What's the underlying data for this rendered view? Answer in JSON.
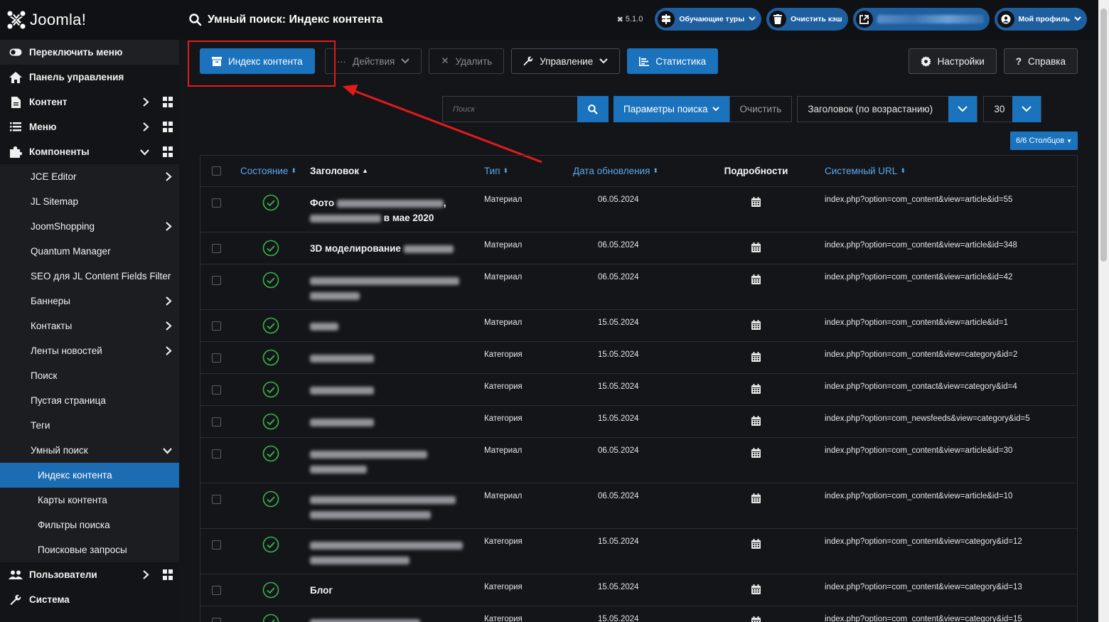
{
  "header": {
    "brand": "Joomla!",
    "title": "Умный поиск: Индекс контента",
    "version": "5.1.0",
    "tours_label": "Обучающие туры",
    "clear_cache_label": "Очистить кэш",
    "profile_label": "Мой профиль"
  },
  "sidebar": {
    "items": [
      {
        "label": "Переключить меню",
        "icon": "toggle-icon"
      },
      {
        "label": "Панель управления",
        "icon": "home-icon"
      },
      {
        "label": "Контент",
        "icon": "file-icon"
      },
      {
        "label": "Меню",
        "icon": "list-icon"
      },
      {
        "label": "Компоненты",
        "icon": "puzzle-icon"
      },
      {
        "label": "JCE Editor"
      },
      {
        "label": "JL Sitemap"
      },
      {
        "label": "JoomShopping"
      },
      {
        "label": "Quantum Manager"
      },
      {
        "label": "SEO для JL Content Fields Filter"
      },
      {
        "label": "Баннеры"
      },
      {
        "label": "Контакты"
      },
      {
        "label": "Ленты новостей"
      },
      {
        "label": "Поиск"
      },
      {
        "label": "Пустая страница"
      },
      {
        "label": "Теги"
      },
      {
        "label": "Умный поиск"
      },
      {
        "label": "Индекс контента"
      },
      {
        "label": "Карты контента"
      },
      {
        "label": "Фильтры поиска"
      },
      {
        "label": "Поисковые запросы"
      },
      {
        "label": "Пользователи",
        "icon": "users-icon"
      },
      {
        "label": "Система",
        "icon": "wrench-icon"
      }
    ]
  },
  "toolbar": {
    "index_label": "Индекс контента",
    "actions_label": "Действия",
    "delete_label": "Удалить",
    "manage_label": "Управление",
    "stats_label": "Статистика",
    "options_label": "Настройки",
    "help_label": "Справка"
  },
  "filters": {
    "search_placeholder": "Поиск",
    "params_label": "Параметры поиска",
    "clear_label": "Очистить",
    "sort_value": "Заголовок (по возрастанию)",
    "limit_value": "30",
    "columns_label": "6/6 Столбцов"
  },
  "table": {
    "headers": {
      "state": "Состояние",
      "title": "Заголовок",
      "type": "Тип",
      "date": "Дата обновления",
      "details": "Подробности",
      "url": "Системный URL"
    },
    "rows": [
      {
        "title": "Фото",
        "title2": "в мае 2020",
        "type": "Материал",
        "date": "06.05.2024",
        "url": "index.php?option=com_content&view=article&id=55"
      },
      {
        "title": "3D моделирование",
        "title2": "",
        "type": "Материал",
        "date": "06.05.2024",
        "url": "index.php?option=com_content&view=article&id=348"
      },
      {
        "title": "",
        "title2": "",
        "type": "Материал",
        "date": "06.05.2024",
        "url": "index.php?option=com_content&view=article&id=42"
      },
      {
        "title": "",
        "title2": "",
        "type": "Материал",
        "date": "15.05.2024",
        "url": "index.php?option=com_content&view=article&id=1"
      },
      {
        "title": "",
        "title2": "",
        "type": "Категория",
        "date": "15.05.2024",
        "url": "index.php?option=com_content&view=category&id=2"
      },
      {
        "title": "",
        "title2": "",
        "type": "Категория",
        "date": "15.05.2024",
        "url": "index.php?option=com_contact&view=category&id=4"
      },
      {
        "title": "",
        "title2": "",
        "type": "Категория",
        "date": "15.05.2024",
        "url": "index.php?option=com_newsfeeds&view=category&id=5"
      },
      {
        "title": "",
        "title2": "",
        "type": "Материал",
        "date": "06.05.2024",
        "url": "index.php?option=com_content&view=article&id=30"
      },
      {
        "title": "",
        "title2": "",
        "type": "Материал",
        "date": "06.05.2024",
        "url": "index.php?option=com_content&view=article&id=10"
      },
      {
        "title": "",
        "title2": "",
        "type": "Категория",
        "date": "15.05.2024",
        "url": "index.php?option=com_content&view=category&id=12"
      },
      {
        "title": "Блог",
        "title2": "",
        "type": "Категория",
        "date": "15.05.2024",
        "url": "index.php?option=com_content&view=category&id=13"
      },
      {
        "title": "",
        "title2": "",
        "type": "Категория",
        "date": "15.05.2024",
        "url": "index.php?option=com_content&view=category&id=15"
      }
    ]
  },
  "colors": {
    "accent": "#1b73be",
    "sidebar_active": "#1b6cb3",
    "annotation_red": "#e41a1a",
    "published_green": "#3bb34a"
  }
}
